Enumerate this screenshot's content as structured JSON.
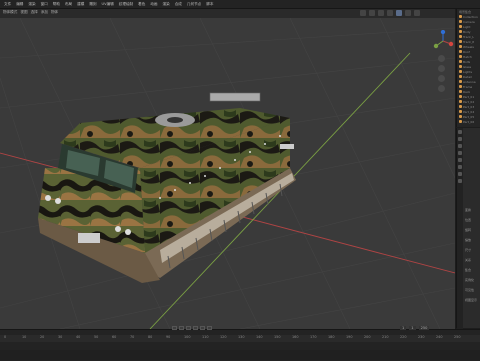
{
  "menu": {
    "items": [
      "文件",
      "编辑",
      "渲染",
      "窗口",
      "帮助",
      "布局",
      "建模",
      "雕刻",
      "UV编辑",
      "纹理绘制",
      "着色",
      "动画",
      "渲染",
      "合成",
      "几何节点",
      "脚本"
    ]
  },
  "toolbar": {
    "left_items": [
      "物体模式",
      "视图",
      "选择",
      "添加",
      "物体"
    ]
  },
  "outliner": {
    "title": "场景集合",
    "items": [
      "Collection",
      "Camera",
      "Light",
      "Body",
      "Track_L",
      "Track_R",
      "Wheels",
      "Roof",
      "Hatch",
      "Bolts",
      "Glass",
      "Lights",
      "Detail",
      "Antenna",
      "Frame",
      "Rack",
      "Part_01",
      "Part_02",
      "Part_03",
      "Part_04",
      "Part_05",
      "Part_06"
    ]
  },
  "properties": {
    "rows": [
      "变换",
      "位置",
      "旋转",
      "缩放",
      "尺寸",
      "关系",
      "集合",
      "实例化",
      "可见性",
      "视图显示"
    ]
  },
  "timeline": {
    "ticks": [
      "0",
      "10",
      "20",
      "30",
      "40",
      "50",
      "60",
      "70",
      "80",
      "90",
      "100",
      "110",
      "120",
      "130",
      "140",
      "150",
      "160",
      "170",
      "180",
      "190",
      "200",
      "210",
      "220",
      "230",
      "240",
      "250"
    ],
    "start": "1",
    "end": "250",
    "current": "1"
  },
  "colors": {
    "accent": "#5a6c8a",
    "grid": "#444444",
    "x_axis": "#b04444",
    "y_axis": "#7aa043"
  }
}
